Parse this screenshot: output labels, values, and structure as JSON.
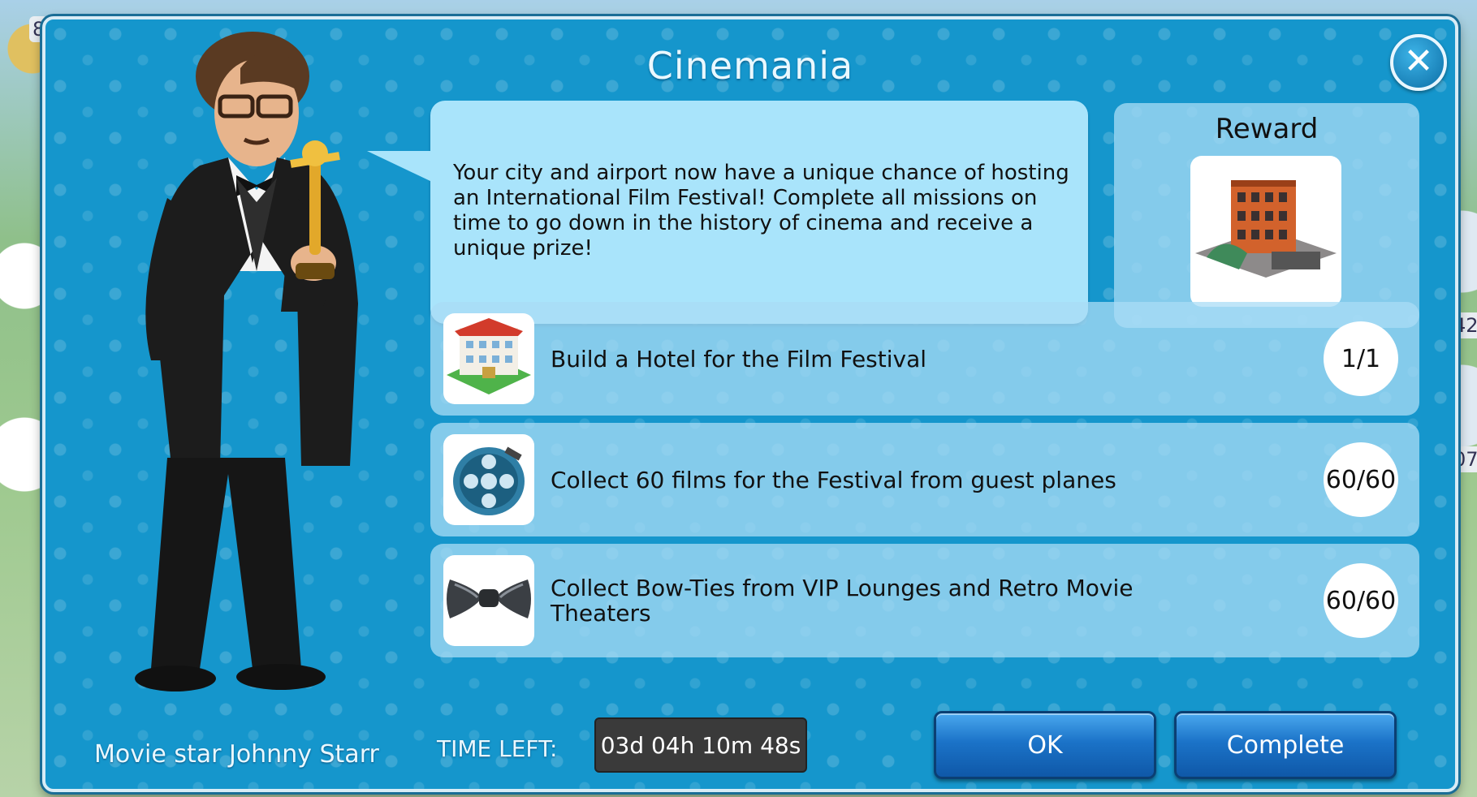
{
  "dialog": {
    "title": "Cinemania",
    "close_icon": "close-icon"
  },
  "character": {
    "name": "Movie star Johnny Starr"
  },
  "speech": {
    "text": "Your city and airport now have a unique chance of hosting an International Film Festival! Complete all missions on time to go down in the history of cinema and receive a unique prize!"
  },
  "reward": {
    "label": "Reward",
    "icon": "hotel-building-icon"
  },
  "missions": [
    {
      "text": "Build a Hotel for the Film Festival",
      "progress": "1/1",
      "icon": "hotel-icon"
    },
    {
      "text": "Collect 60 films for the Festival from guest planes",
      "progress": "60/60",
      "icon": "film-reel-icon"
    },
    {
      "text": "Collect Bow-Ties from VIP Lounges and Retro Movie Theaters",
      "progress": "60/60",
      "icon": "bow-tie-icon"
    }
  ],
  "footer": {
    "time_label": "TIME LEFT:",
    "time_value": "03d 04h 10m 48s",
    "ok_label": "OK",
    "complete_label": "Complete"
  },
  "background": {
    "side_numbers": [
      "8",
      "42",
      "07"
    ]
  },
  "colors": {
    "panel_blue": "#1596cc",
    "bubble": "#a9e4fb",
    "button_blue": "#1b73c8"
  }
}
